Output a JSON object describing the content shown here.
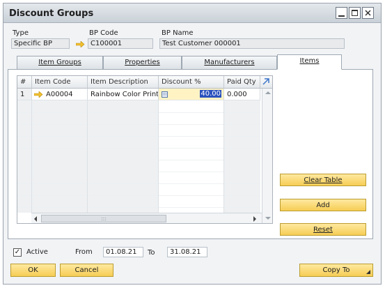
{
  "window": {
    "title": "Discount Groups"
  },
  "header": {
    "type_label": "Type",
    "type_value": "Specific BP",
    "bp_code_label": "BP Code",
    "bp_code_value": "C100001",
    "bp_name_label": "BP Name",
    "bp_name_value": "Test Customer 000001"
  },
  "tabs": [
    {
      "label": "Item Groups",
      "active": false
    },
    {
      "label": "Properties",
      "active": false
    },
    {
      "label": "Manufacturers",
      "active": false
    },
    {
      "label": "Items",
      "active": true
    }
  ],
  "table": {
    "columns": [
      "#",
      "Item Code",
      "Item Description",
      "Discount %",
      "Paid Qty"
    ],
    "rows": [
      {
        "num": "1",
        "item_code": "A00004",
        "item_description": "Rainbow Color Printer",
        "discount": "40.00",
        "paid_qty": "0.000"
      }
    ],
    "scroll_grip": ":::"
  },
  "side_buttons": {
    "clear_table": "Clear Table",
    "add": "Add",
    "reset": "Reset"
  },
  "footer": {
    "active_label": "Active",
    "active_checked": "✓",
    "from_label": "From",
    "from_value": "01.08.21",
    "to_label": "To",
    "to_value": "31.08.21"
  },
  "buttons": {
    "ok": "OK",
    "cancel": "Cancel",
    "copy_to": "Copy To"
  },
  "colors": {
    "accent": "#f6cd55",
    "link_arrow": "#f2c12e",
    "selection": "#2a52be"
  }
}
